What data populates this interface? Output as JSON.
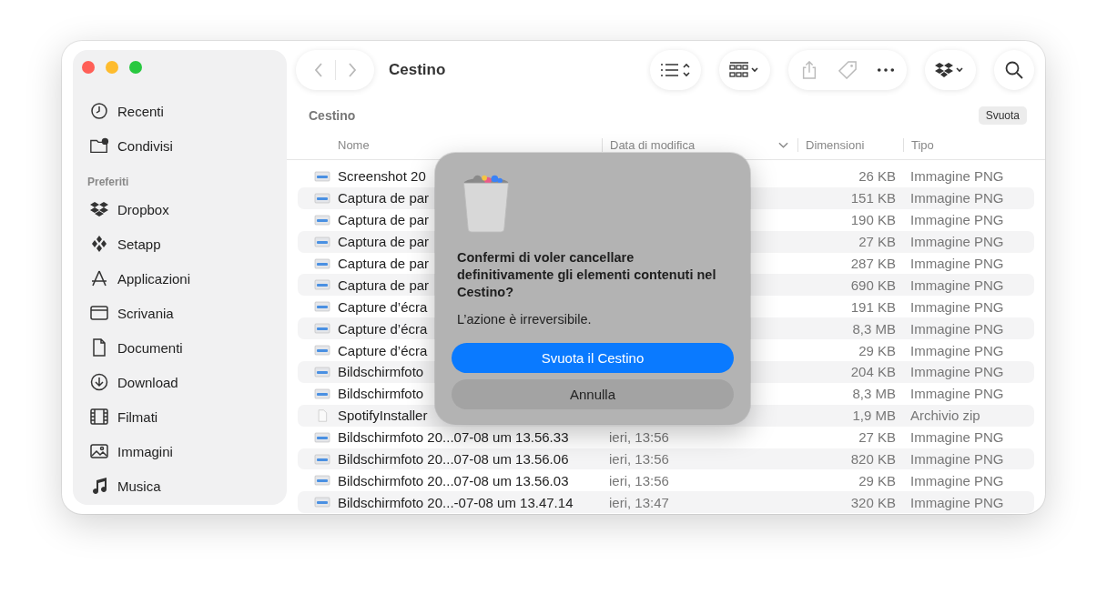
{
  "window": {
    "title": "Cestino"
  },
  "sidebar": {
    "items": [
      {
        "label": "Recenti"
      },
      {
        "label": "Condivisi"
      }
    ],
    "section": "Preferiti",
    "favorites": [
      {
        "label": "Dropbox"
      },
      {
        "label": "Setapp"
      },
      {
        "label": "Applicazioni"
      },
      {
        "label": "Scrivania"
      },
      {
        "label": "Documenti"
      },
      {
        "label": "Download"
      },
      {
        "label": "Filmati"
      },
      {
        "label": "Immagini"
      },
      {
        "label": "Musica"
      }
    ]
  },
  "location": {
    "title": "Cestino",
    "empty_button": "Svuota"
  },
  "table": {
    "columns": [
      "Nome",
      "Data di modifica",
      "Dimensioni",
      "Tipo"
    ],
    "rows": [
      {
        "kind": "image",
        "name": "Screenshot 20",
        "size": "26 KB",
        "type": "Immagine PNG"
      },
      {
        "kind": "image",
        "name": "Captura de par",
        "size": "151 KB",
        "type": "Immagine PNG"
      },
      {
        "kind": "image",
        "name": "Captura de par",
        "size": "190 KB",
        "type": "Immagine PNG"
      },
      {
        "kind": "image",
        "name": "Captura de par",
        "size": "27 KB",
        "type": "Immagine PNG"
      },
      {
        "kind": "image",
        "name": "Captura de par",
        "size": "287 KB",
        "type": "Immagine PNG"
      },
      {
        "kind": "image",
        "name": "Captura de par",
        "size": "690 KB",
        "type": "Immagine PNG"
      },
      {
        "kind": "image",
        "name": "Capture d’écra",
        "size": "191 KB",
        "type": "Immagine PNG"
      },
      {
        "kind": "image",
        "name": "Capture d’écra",
        "size": "8,3 MB",
        "type": "Immagine PNG"
      },
      {
        "kind": "image",
        "name": "Capture d’écra",
        "size": "29 KB",
        "type": "Immagine PNG"
      },
      {
        "kind": "image",
        "name": "Bildschirmfoto",
        "size": "204 KB",
        "type": "Immagine PNG"
      },
      {
        "kind": "image",
        "name": "Bildschirmfoto",
        "size": "8,3 MB",
        "type": "Immagine PNG"
      },
      {
        "kind": "document",
        "name": "SpotifyInstaller",
        "size": "1,9 MB",
        "type": "Archivio zip"
      },
      {
        "kind": "image",
        "name": "Bildschirmfoto 20...07-08 um 13.56.33",
        "date": "ieri, 13:56",
        "size": "27 KB",
        "type": "Immagine PNG"
      },
      {
        "kind": "image",
        "name": "Bildschirmfoto 20...07-08 um 13.56.06",
        "date": "ieri, 13:56",
        "size": "820 KB",
        "type": "Immagine PNG"
      },
      {
        "kind": "image",
        "name": "Bildschirmfoto 20...07-08 um 13.56.03",
        "date": "ieri, 13:56",
        "size": "29 KB",
        "type": "Immagine PNG"
      },
      {
        "kind": "image",
        "name": "Bildschirmfoto 20...-07-08 um 13.47.14",
        "date": "ieri, 13:47",
        "size": "320 KB",
        "type": "Immagine PNG"
      }
    ]
  },
  "dialog": {
    "title": "Confermi di voler cancellare definitivamente gli elementi contenuti nel Cestino?",
    "message": "L’azione è irreversibile.",
    "buttons": [
      {
        "label": "Svuota il Cestino",
        "kind": "primary"
      },
      {
        "label": "Annulla",
        "kind": "secondary"
      }
    ]
  }
}
